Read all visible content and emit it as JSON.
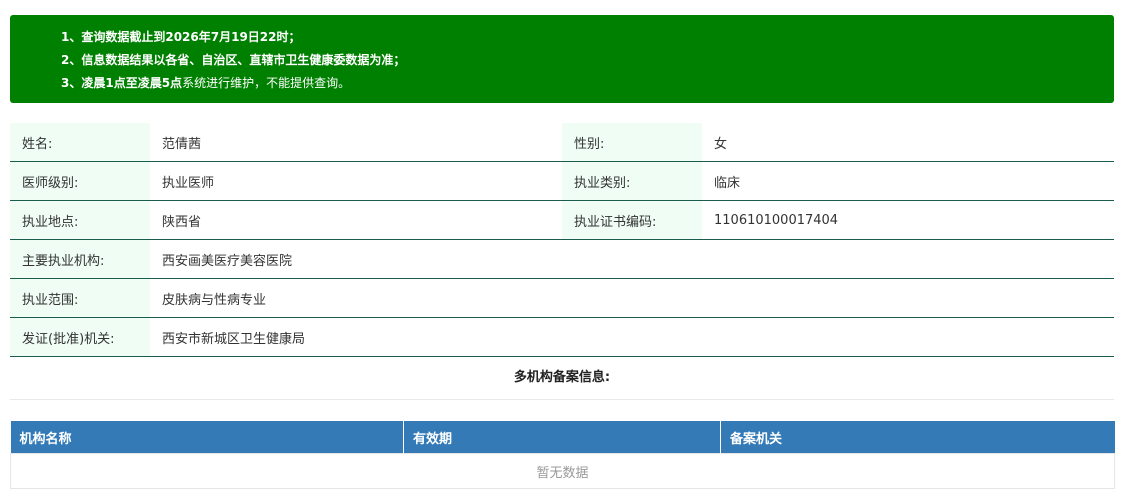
{
  "notice": {
    "lines": [
      {
        "prefix": "1、查询数据截止到2026年7月19日22时；",
        "rest": ""
      },
      {
        "prefix": "2、信息数据结果以各省、自治区、直辖市卫生健康委数据为准；",
        "rest": ""
      },
      {
        "prefix": "3、凌晨1点至凌晨5点",
        "rest": "系统进行维护，不能提供查询。"
      }
    ]
  },
  "doctor": {
    "name_label": "姓名:",
    "name": "范倩茜",
    "gender_label": "性别:",
    "gender": "女",
    "level_label": "医师级别:",
    "level": "执业医师",
    "category_label": "执业类别:",
    "category": "临床",
    "location_label": "执业地点:",
    "location": "陕西省",
    "cert_label": "执业证书编码:",
    "cert": "110610100017404",
    "org_label": "主要执业机构:",
    "org": "西安画美医疗美容医院",
    "scope_label": "执业范围:",
    "scope": "皮肤病与性病专业",
    "issuer_label": "发证(批准)机关:",
    "issuer": "西安市新城区卫生健康局"
  },
  "multi_org": {
    "title": "多机构备案信息:",
    "columns": [
      "机构名称",
      "有效期",
      "备案机关"
    ],
    "empty_text": "暂无数据"
  },
  "colors": {
    "notice_bg": "#008000",
    "label_bg": "#effdf5",
    "row_border": "#1a5c4e",
    "table_header_bg": "#337ab7"
  }
}
